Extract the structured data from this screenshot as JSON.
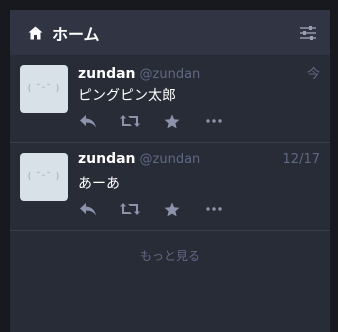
{
  "column": {
    "title": "ホーム",
    "icon": "home-icon",
    "settings_icon": "sliders-icon"
  },
  "statuses": [
    {
      "avatar_text": "( ˘ᵕ˘ )",
      "display_name": "zundan",
      "acct": "@zundan",
      "time": "今",
      "content": "ピングピン太郎"
    },
    {
      "avatar_text": "( ˘ᵕ˘ )",
      "display_name": "zundan",
      "acct": "@zundan",
      "time": "12/17",
      "content": "あーあ"
    }
  ],
  "load_more": "もっと見る",
  "colors": {
    "background": "#17191f",
    "column_bg": "#282c37",
    "header_bg": "#313543",
    "muted": "#606984",
    "icon": "#8d93ab"
  }
}
